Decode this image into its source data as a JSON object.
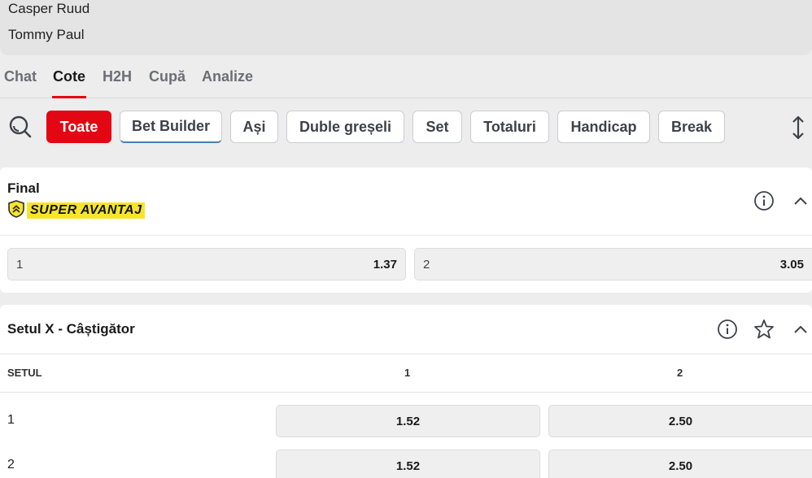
{
  "match": {
    "player1": "Casper Ruud",
    "player2": "Tommy Paul"
  },
  "tabs": [
    {
      "label": "Chat",
      "active": false
    },
    {
      "label": "Cote",
      "active": true
    },
    {
      "label": "H2H",
      "active": false
    },
    {
      "label": "Cupă",
      "active": false
    },
    {
      "label": "Analize",
      "active": false
    }
  ],
  "filters": [
    {
      "label": "Toate",
      "active": true
    },
    {
      "label": "Bet Builder",
      "active": false
    },
    {
      "label": "Ași",
      "active": false
    },
    {
      "label": "Duble greșeli",
      "active": false
    },
    {
      "label": "Set",
      "active": false
    },
    {
      "label": "Totaluri",
      "active": false
    },
    {
      "label": "Handicap",
      "active": false
    },
    {
      "label": "Break",
      "active": false
    }
  ],
  "final_market": {
    "title": "Final",
    "badge": "SUPER AVANTAJ",
    "odds": [
      {
        "label": "1",
        "value": "1.37"
      },
      {
        "label": "2",
        "value": "3.05"
      }
    ]
  },
  "set_market": {
    "title": "Setul X - Câștigător",
    "columns": [
      "SETUL",
      "1",
      "2"
    ],
    "rows": [
      {
        "set": "1",
        "odd1": "1.52",
        "odd2": "2.50"
      },
      {
        "set": "2",
        "odd1": "1.52",
        "odd2": "2.50"
      }
    ]
  },
  "colors": {
    "accent": "#e30613",
    "badge": "#f7e52b"
  },
  "icons": [
    "search-icon",
    "sort-icon",
    "info-icon",
    "chevron-up-icon",
    "star-icon",
    "shield-chevron-icon"
  ]
}
